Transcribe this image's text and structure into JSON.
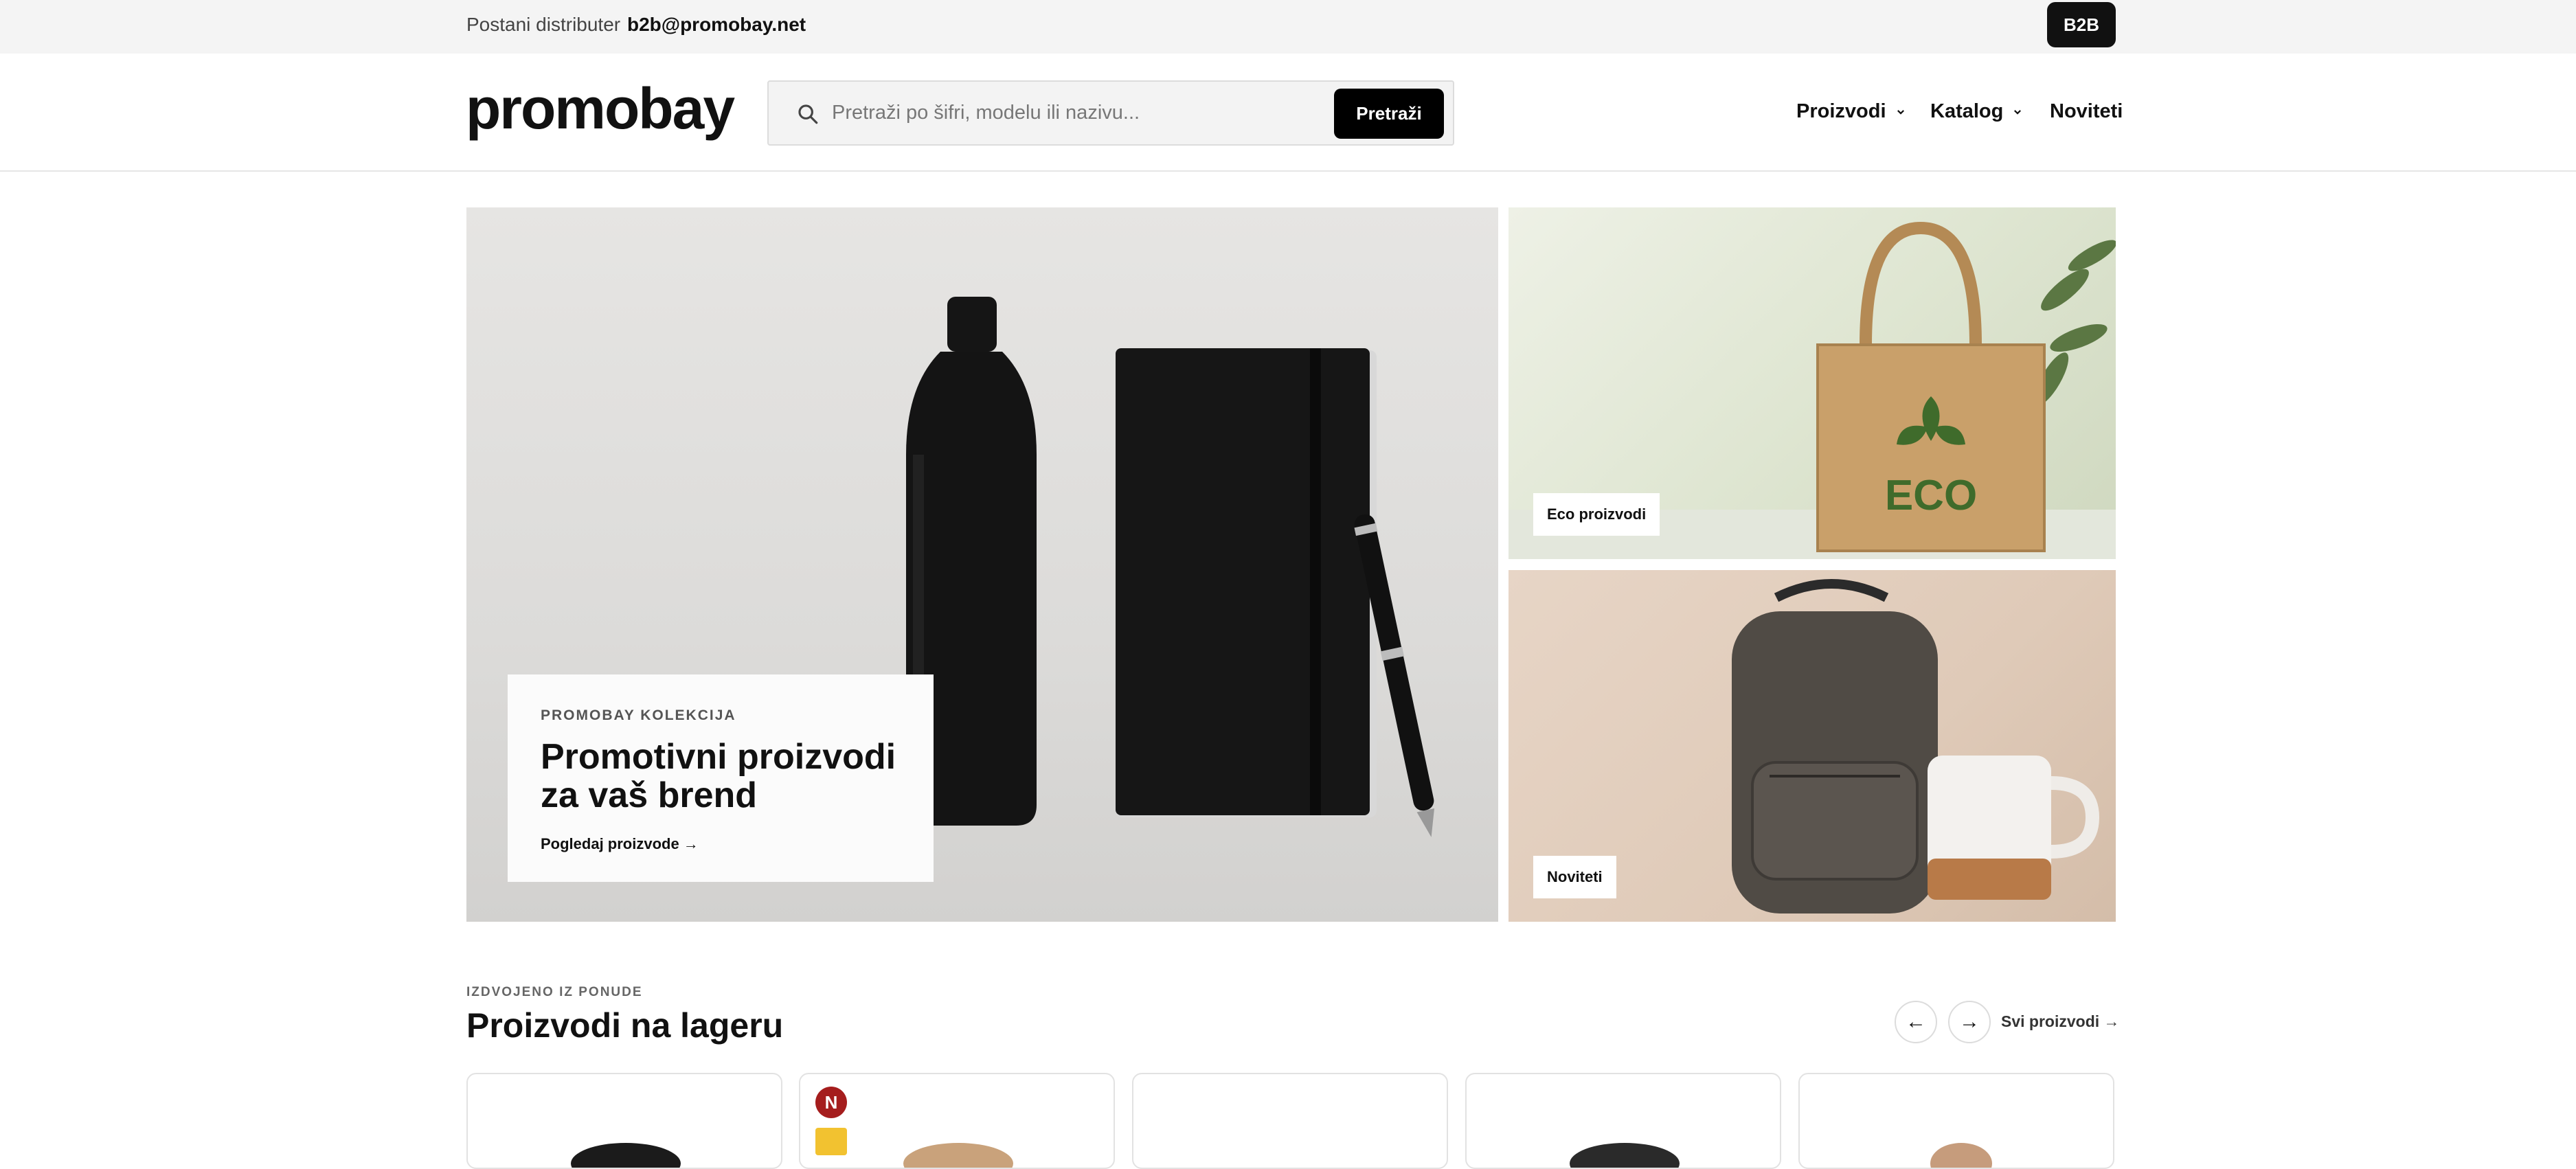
{
  "topbar": {
    "distributor_text": "Postani distributer",
    "email": "b2b@promobay.net",
    "b2b_button": "B2B"
  },
  "header": {
    "logo": "promobay",
    "search": {
      "placeholder": "Pretraži po šifri, modelu ili nazivu...",
      "button": "Pretraži"
    },
    "nav": [
      {
        "label": "Proizvodi",
        "has_dropdown": true
      },
      {
        "label": "Katalog",
        "has_dropdown": true
      },
      {
        "label": "Noviteti",
        "has_dropdown": false
      }
    ]
  },
  "hero": {
    "eyebrow": "PROMOBAY KOLEKCIJA",
    "title": "Promotivni proizvodi za vaš brend",
    "link": "Pogledaj proizvode →",
    "image_text": "ECO",
    "tiles": [
      {
        "label": "Eco proizvodi"
      },
      {
        "label": "Noviteti"
      }
    ]
  },
  "section": {
    "eyebrow": "IZDVOJENO IZ PONUDE",
    "title": "Proizvodi na lageru",
    "prev": "←",
    "next": "→",
    "all_link": "Svi proizvodi →",
    "card_badge": "N"
  },
  "colors": {
    "accent": "#000000",
    "badge_red": "#a51d1d",
    "topbar_bg": "#f4f4f4"
  }
}
